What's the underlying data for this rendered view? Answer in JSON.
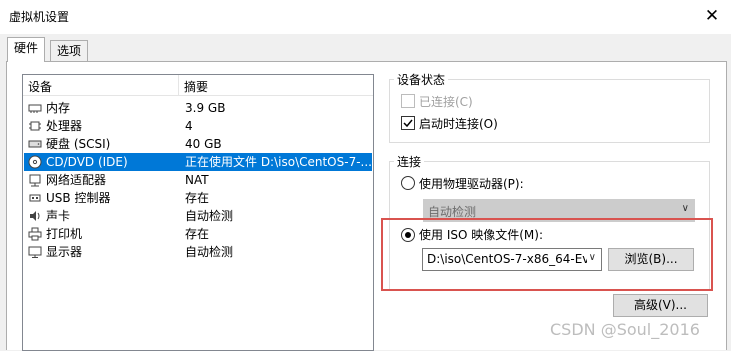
{
  "window": {
    "title": "虚拟机设置"
  },
  "tabs": [
    {
      "label": "硬件"
    },
    {
      "label": "选项"
    }
  ],
  "device_list": {
    "headers": {
      "device": "设备",
      "summary": "摘要"
    },
    "rows": [
      {
        "icon": "memory-icon",
        "name": "内存",
        "summary": "3.9 GB"
      },
      {
        "icon": "cpu-icon",
        "name": "处理器",
        "summary": "4"
      },
      {
        "icon": "disk-icon",
        "name": "硬盘 (SCSI)",
        "summary": "40 GB"
      },
      {
        "icon": "cd-icon",
        "name": "CD/DVD (IDE)",
        "summary": "正在使用文件 D:\\iso\\CentOS-7-..."
      },
      {
        "icon": "network-icon",
        "name": "网络适配器",
        "summary": "NAT"
      },
      {
        "icon": "usb-icon",
        "name": "USB 控制器",
        "summary": "存在"
      },
      {
        "icon": "sound-icon",
        "name": "声卡",
        "summary": "自动检测"
      },
      {
        "icon": "printer-icon",
        "name": "打印机",
        "summary": "存在"
      },
      {
        "icon": "display-icon",
        "name": "显示器",
        "summary": "自动检测"
      }
    ]
  },
  "device_status": {
    "title": "设备状态",
    "connected_label": "已连接(C)",
    "connect_on_start_label": "启动时连接(O)"
  },
  "connection": {
    "title": "连接",
    "physical_label": "使用物理驱动器(P):",
    "physical_select": "自动检测",
    "iso_label": "使用 ISO 映像文件(M):",
    "iso_path": "D:\\iso\\CentOS-7-x86_64-Ev",
    "browse_label": "浏览(B)..."
  },
  "advanced_label": "高级(V)...",
  "watermark": "CSDN @Soul_2016",
  "colors": {
    "selection": "#0078d7",
    "highlight_box": "#d9534f"
  }
}
